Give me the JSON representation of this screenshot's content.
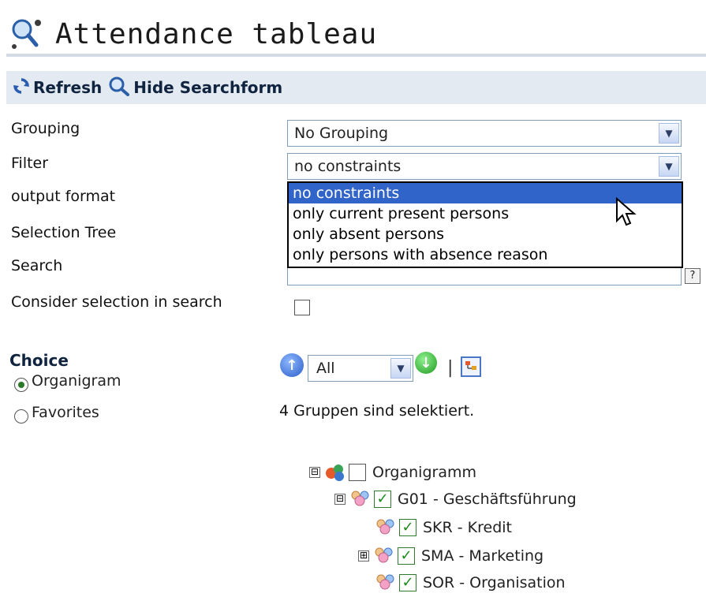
{
  "page": {
    "title": "Attendance tableau"
  },
  "toolbar": {
    "refresh_label": "Refresh",
    "hide_search_label": "Hide Searchform"
  },
  "form": {
    "grouping_label": "Grouping",
    "grouping_value": "No Grouping",
    "filter_label": "Filter",
    "filter_value": "no constraints",
    "filter_options": [
      "no constraints",
      "only current present persons",
      "only absent persons",
      "only persons with absence reason"
    ],
    "filter_selected_index": 0,
    "output_format_label": "output format",
    "selection_tree_label": "Selection Tree",
    "search_label": "Search",
    "search_value": "",
    "help_glyph": "?",
    "consider_selection_label": "Consider selection in search",
    "consider_selection_checked": false
  },
  "choice": {
    "heading": "Choice",
    "options": [
      "Organigram",
      "Favorites"
    ],
    "selected": "Organigram",
    "level_value": "All",
    "status_text": "4 Gruppen sind selektiert."
  },
  "tree": {
    "root": {
      "label": "Organigramm",
      "checked": false,
      "expander": "⊟"
    },
    "nodes": [
      {
        "label": "G01 - Geschäftsführung",
        "checked": true,
        "expander": "⊟"
      },
      {
        "label": "SKR - Kredit",
        "checked": true,
        "expander": ""
      },
      {
        "label": "SMA - Marketing",
        "checked": true,
        "expander": "⊞"
      },
      {
        "label": "SOR - Organisation",
        "checked": true,
        "expander": ""
      }
    ]
  },
  "colors": {
    "toolbar_bg": "#e4eaf2",
    "dropdown_highlight": "#3164c8",
    "accent_blue": "#4a78c6",
    "check_green": "#1a8a1a"
  },
  "icons": {
    "title": "search-people-icon",
    "refresh": "refresh-icon",
    "hide_search": "magnifier-icon",
    "level_up": "arrow-up-circle-icon",
    "level_down": "arrow-down-circle-icon",
    "tree_view": "tree-view-icon",
    "group": "group-people-icon",
    "org_root": "organigram-icon",
    "cursor": "mouse-cursor-icon"
  }
}
